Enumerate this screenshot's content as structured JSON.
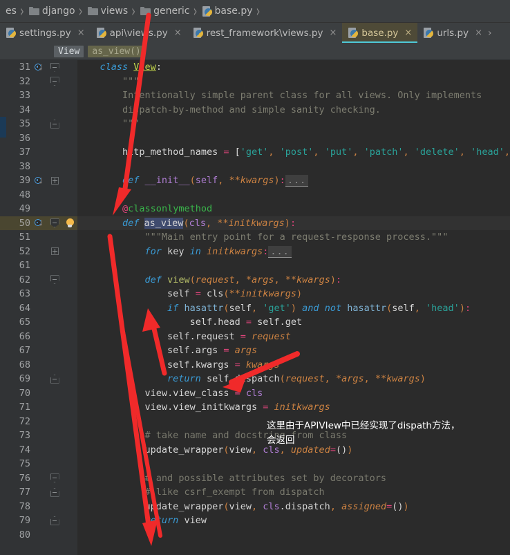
{
  "breadcrumb": {
    "items": [
      {
        "label": "es",
        "icon": "none"
      },
      {
        "label": "django",
        "icon": "folder-icon"
      },
      {
        "label": "views",
        "icon": "folder-icon"
      },
      {
        "label": "generic",
        "icon": "folder-icon"
      },
      {
        "label": "base.py",
        "icon": "python-file-icon"
      }
    ],
    "separator": "›"
  },
  "tabs": {
    "items": [
      {
        "label": "settings.py",
        "active": false,
        "close": "×"
      },
      {
        "label": "api\\views.py",
        "active": false,
        "close": "×"
      },
      {
        "label": "rest_framework\\views.py",
        "active": false,
        "close": "×"
      },
      {
        "label": "base.py",
        "active": true,
        "close": "×"
      },
      {
        "label": "urls.py",
        "active": false,
        "close": "×"
      }
    ],
    "overflow_chevron": "›"
  },
  "navbar": {
    "class_chip": "View",
    "method_chip": "as_view()"
  },
  "colors": {
    "editor_bg": "#2b2b2b",
    "gutter_bg": "#313335",
    "tab_active_bg": "#4e4a37",
    "tab_active_underline": "#4ec9d8",
    "caret_row_bg": "#323232",
    "annotation_arrow": "#f02a2a",
    "selection": "#3f4b6e",
    "left_marker": "#1b3a57"
  },
  "annotation": {
    "line1": "这里由于APIVIew中已经实现了dispath方法，",
    "line2": "会返回"
  },
  "editor": {
    "language": "Python",
    "file": "base.py",
    "caret_line": 50,
    "lines": [
      {
        "n": "31",
        "gutter": {
          "override": true,
          "fold": "start"
        },
        "tokens": [
          {
            "t": "    ",
            "c": "plain"
          },
          {
            "t": "class ",
            "c": "kwc"
          },
          {
            "t": "View",
            "c": "clsname"
          },
          {
            "t": ":",
            "c": "white"
          }
        ]
      },
      {
        "n": "32",
        "gutter": {
          "fold": "start",
          "foldline": true
        },
        "tokens": [
          {
            "t": "        ",
            "c": "plain"
          },
          {
            "t": "\"\"\"",
            "c": "doc"
          }
        ]
      },
      {
        "n": "33",
        "gutter": {
          "foldline": true
        },
        "tokens": [
          {
            "t": "        ",
            "c": "plain"
          },
          {
            "t": "Intentionally simple parent class for all views. Only implements",
            "c": "doc"
          }
        ]
      },
      {
        "n": "34",
        "gutter": {
          "foldline": true
        },
        "tokens": [
          {
            "t": "        ",
            "c": "plain"
          },
          {
            "t": "dispatch-by-method and simple sanity checking.",
            "c": "doc"
          }
        ]
      },
      {
        "n": "35",
        "gutter": {
          "fold": "end",
          "foldline": true
        },
        "marker": true,
        "tokens": [
          {
            "t": "        ",
            "c": "plain"
          },
          {
            "t": "\"\"\"",
            "c": "doc"
          }
        ]
      },
      {
        "n": "36",
        "gutter": {
          "foldline": true
        },
        "tokens": []
      },
      {
        "n": "37",
        "gutter": {
          "foldline": true
        },
        "tokens": [
          {
            "t": "        ",
            "c": "plain"
          },
          {
            "t": "http_method_names",
            "c": "white"
          },
          {
            "t": " = ",
            "c": "op"
          },
          {
            "t": "[",
            "c": "white"
          },
          {
            "t": "'get'",
            "c": "str"
          },
          {
            "t": ", ",
            "c": "paramp"
          },
          {
            "t": "'post'",
            "c": "str"
          },
          {
            "t": ", ",
            "c": "paramp"
          },
          {
            "t": "'put'",
            "c": "str"
          },
          {
            "t": ", ",
            "c": "paramp"
          },
          {
            "t": "'patch'",
            "c": "str"
          },
          {
            "t": ", ",
            "c": "paramp"
          },
          {
            "t": "'delete'",
            "c": "str"
          },
          {
            "t": ", ",
            "c": "paramp"
          },
          {
            "t": "'head'",
            "c": "str"
          },
          {
            "t": ",",
            "c": "paramp"
          }
        ]
      },
      {
        "n": "38",
        "gutter": {
          "foldline": true
        },
        "tokens": []
      },
      {
        "n": "39",
        "gutter": {
          "override": true,
          "fold": "plus",
          "foldline": true
        },
        "tokens": [
          {
            "t": "        ",
            "c": "plain"
          },
          {
            "t": "def ",
            "c": "kwc"
          },
          {
            "t": "__init__",
            "c": "mag"
          },
          {
            "t": "(",
            "c": "paramp"
          },
          {
            "t": "self",
            "c": "mag"
          },
          {
            "t": ", ",
            "c": "paramp"
          },
          {
            "t": "**kwargs",
            "c": "param"
          },
          {
            "t": ")",
            "c": "paramp"
          },
          {
            "t": ":",
            "c": "op"
          },
          {
            "t": "...",
            "c": "ellipsis"
          }
        ]
      },
      {
        "n": "48",
        "gutter": {
          "foldline": true
        },
        "tokens": []
      },
      {
        "n": "49",
        "gutter": {
          "foldline": true
        },
        "tokens": [
          {
            "t": "        ",
            "c": "plain"
          },
          {
            "t": "@",
            "c": "at"
          },
          {
            "t": "classonlymethod",
            "c": "deco"
          }
        ]
      },
      {
        "n": "50",
        "caret": true,
        "gutter": {
          "override": true,
          "fold": "start",
          "bulb": true
        },
        "tokens": [
          {
            "t": "        ",
            "c": "plain"
          },
          {
            "t": "def ",
            "c": "kwc"
          },
          {
            "t": "as_view",
            "c": "sel-asview"
          },
          {
            "t": "(",
            "c": "paramp"
          },
          {
            "t": "cls",
            "c": "mag"
          },
          {
            "t": ", ",
            "c": "paramp"
          },
          {
            "t": "**initkwargs",
            "c": "param"
          },
          {
            "t": ")",
            "c": "paramp"
          },
          {
            "t": ":",
            "c": "op"
          }
        ]
      },
      {
        "n": "51",
        "gutter": {
          "foldline": true
        },
        "tokens": [
          {
            "t": "            ",
            "c": "plain"
          },
          {
            "t": "\"\"\"Main entry point for a request-response process.\"\"\"",
            "c": "doc"
          }
        ]
      },
      {
        "n": "52",
        "gutter": {
          "fold": "plus",
          "foldline": true
        },
        "tokens": [
          {
            "t": "            ",
            "c": "plain"
          },
          {
            "t": "for ",
            "c": "kwc"
          },
          {
            "t": "key ",
            "c": "white"
          },
          {
            "t": "in ",
            "c": "kwc"
          },
          {
            "t": "initkwargs",
            "c": "param"
          },
          {
            "t": ":",
            "c": "op"
          },
          {
            "t": "...",
            "c": "ellipsis"
          }
        ]
      },
      {
        "n": "61",
        "gutter": {
          "foldline": true
        },
        "tokens": []
      },
      {
        "n": "62",
        "gutter": {
          "fold": "start",
          "foldline": true
        },
        "tokens": [
          {
            "t": "            ",
            "c": "plain"
          },
          {
            "t": "def ",
            "c": "kwc"
          },
          {
            "t": "view",
            "c": "fn"
          },
          {
            "t": "(",
            "c": "paramp"
          },
          {
            "t": "request",
            "c": "param"
          },
          {
            "t": ", ",
            "c": "paramp"
          },
          {
            "t": "*args",
            "c": "param"
          },
          {
            "t": ", ",
            "c": "paramp"
          },
          {
            "t": "**kwargs",
            "c": "param"
          },
          {
            "t": ")",
            "c": "paramp"
          },
          {
            "t": ":",
            "c": "op"
          }
        ]
      },
      {
        "n": "63",
        "gutter": {
          "foldline": true
        },
        "tokens": [
          {
            "t": "                ",
            "c": "plain"
          },
          {
            "t": "self",
            "c": "white"
          },
          {
            "t": " = ",
            "c": "op"
          },
          {
            "t": "cls",
            "c": "white"
          },
          {
            "t": "(",
            "c": "paramp"
          },
          {
            "t": "**initkwargs",
            "c": "param"
          },
          {
            "t": ")",
            "c": "paramp"
          }
        ]
      },
      {
        "n": "64",
        "gutter": {
          "foldline": true
        },
        "tokens": [
          {
            "t": "                ",
            "c": "plain"
          },
          {
            "t": "if ",
            "c": "kwc"
          },
          {
            "t": "hasattr",
            "c": "fnblue"
          },
          {
            "t": "(",
            "c": "paramp"
          },
          {
            "t": "self",
            "c": "white"
          },
          {
            "t": ", ",
            "c": "paramp"
          },
          {
            "t": "'get'",
            "c": "str"
          },
          {
            "t": ")",
            "c": "paramp"
          },
          {
            "t": " and ",
            "c": "kwc"
          },
          {
            "t": "not ",
            "c": "kwc"
          },
          {
            "t": "hasattr",
            "c": "fnblue"
          },
          {
            "t": "(",
            "c": "paramp"
          },
          {
            "t": "self",
            "c": "white"
          },
          {
            "t": ", ",
            "c": "paramp"
          },
          {
            "t": "'head'",
            "c": "str"
          },
          {
            "t": ")",
            "c": "paramp"
          },
          {
            "t": ":",
            "c": "op"
          }
        ]
      },
      {
        "n": "65",
        "gutter": {
          "foldline": true
        },
        "tokens": [
          {
            "t": "                    ",
            "c": "plain"
          },
          {
            "t": "self",
            "c": "white"
          },
          {
            "t": ".head",
            "c": "white"
          },
          {
            "t": " = ",
            "c": "op"
          },
          {
            "t": "self",
            "c": "white"
          },
          {
            "t": ".get",
            "c": "white"
          }
        ]
      },
      {
        "n": "66",
        "gutter": {
          "foldline": true
        },
        "tokens": [
          {
            "t": "                ",
            "c": "plain"
          },
          {
            "t": "self",
            "c": "white"
          },
          {
            "t": ".request",
            "c": "white"
          },
          {
            "t": " = ",
            "c": "op"
          },
          {
            "t": "request",
            "c": "param"
          }
        ]
      },
      {
        "n": "67",
        "gutter": {
          "foldline": true
        },
        "tokens": [
          {
            "t": "                ",
            "c": "plain"
          },
          {
            "t": "self",
            "c": "white"
          },
          {
            "t": ".args",
            "c": "white"
          },
          {
            "t": " = ",
            "c": "op"
          },
          {
            "t": "args",
            "c": "param"
          }
        ]
      },
      {
        "n": "68",
        "gutter": {
          "foldline": true
        },
        "tokens": [
          {
            "t": "                ",
            "c": "plain"
          },
          {
            "t": "self",
            "c": "white"
          },
          {
            "t": ".kwargs",
            "c": "white"
          },
          {
            "t": " = ",
            "c": "op"
          },
          {
            "t": "kwargs",
            "c": "param"
          }
        ]
      },
      {
        "n": "69",
        "gutter": {
          "fold": "end",
          "foldline": true
        },
        "tokens": [
          {
            "t": "                ",
            "c": "plain"
          },
          {
            "t": "return ",
            "c": "kwc"
          },
          {
            "t": "self",
            "c": "white"
          },
          {
            "t": ".dispatch",
            "c": "white"
          },
          {
            "t": "(",
            "c": "paramp"
          },
          {
            "t": "request",
            "c": "param"
          },
          {
            "t": ", ",
            "c": "paramp"
          },
          {
            "t": "*args",
            "c": "param"
          },
          {
            "t": ", ",
            "c": "paramp"
          },
          {
            "t": "**kwargs",
            "c": "param"
          },
          {
            "t": ")",
            "c": "paramp"
          }
        ]
      },
      {
        "n": "70",
        "gutter": {
          "foldline": true
        },
        "tokens": [
          {
            "t": "            ",
            "c": "plain"
          },
          {
            "t": "view",
            "c": "white"
          },
          {
            "t": ".view_class",
            "c": "white"
          },
          {
            "t": " = ",
            "c": "op"
          },
          {
            "t": "cls",
            "c": "mag"
          }
        ]
      },
      {
        "n": "71",
        "gutter": {
          "foldline": true
        },
        "tokens": [
          {
            "t": "            ",
            "c": "plain"
          },
          {
            "t": "view",
            "c": "white"
          },
          {
            "t": ".view_initkwargs",
            "c": "white"
          },
          {
            "t": " = ",
            "c": "op"
          },
          {
            "t": "initkwargs",
            "c": "param"
          }
        ]
      },
      {
        "n": "72",
        "gutter": {
          "foldline": true
        },
        "tokens": []
      },
      {
        "n": "73",
        "gutter": {
          "foldline": true
        },
        "tokens": [
          {
            "t": "            ",
            "c": "plain"
          },
          {
            "t": "# take name and docstring from class",
            "c": "cmt"
          }
        ]
      },
      {
        "n": "74",
        "gutter": {
          "foldline": true
        },
        "tokens": [
          {
            "t": "            ",
            "c": "plain"
          },
          {
            "t": "update_wrapper",
            "c": "white"
          },
          {
            "t": "(",
            "c": "paramp"
          },
          {
            "t": "view",
            "c": "white"
          },
          {
            "t": ", ",
            "c": "paramp"
          },
          {
            "t": "cls",
            "c": "mag"
          },
          {
            "t": ", ",
            "c": "paramp"
          },
          {
            "t": "updated",
            "c": "param"
          },
          {
            "t": "=",
            "c": "op"
          },
          {
            "t": "()",
            "c": "white"
          },
          {
            "t": ")",
            "c": "paramp"
          }
        ]
      },
      {
        "n": "75",
        "gutter": {
          "foldline": true
        },
        "tokens": []
      },
      {
        "n": "76",
        "gutter": {
          "fold": "start",
          "foldline": true
        },
        "tokens": [
          {
            "t": "            ",
            "c": "plain"
          },
          {
            "t": "# and possible attributes set by decorators",
            "c": "cmt"
          }
        ]
      },
      {
        "n": "77",
        "gutter": {
          "fold": "end",
          "foldline": true
        },
        "tokens": [
          {
            "t": "            ",
            "c": "plain"
          },
          {
            "t": "# like csrf_exempt from dispatch",
            "c": "cmt"
          }
        ]
      },
      {
        "n": "78",
        "gutter": {
          "foldline": true
        },
        "tokens": [
          {
            "t": "            ",
            "c": "plain"
          },
          {
            "t": "update_wrapper",
            "c": "white"
          },
          {
            "t": "(",
            "c": "paramp"
          },
          {
            "t": "view",
            "c": "white"
          },
          {
            "t": ", ",
            "c": "paramp"
          },
          {
            "t": "cls",
            "c": "mag"
          },
          {
            "t": ".dispatch",
            "c": "white"
          },
          {
            "t": ", ",
            "c": "paramp"
          },
          {
            "t": "assigned",
            "c": "param"
          },
          {
            "t": "=",
            "c": "op"
          },
          {
            "t": "()",
            "c": "white"
          },
          {
            "t": ")",
            "c": "paramp"
          }
        ]
      },
      {
        "n": "79",
        "gutter": {
          "fold": "end",
          "foldline": true
        },
        "tokens": [
          {
            "t": "            ",
            "c": "plain"
          },
          {
            "t": "return ",
            "c": "kwc"
          },
          {
            "t": "view",
            "c": "white"
          }
        ]
      },
      {
        "n": "80",
        "gutter": {
          "foldline": true
        },
        "tokens": []
      }
    ]
  }
}
